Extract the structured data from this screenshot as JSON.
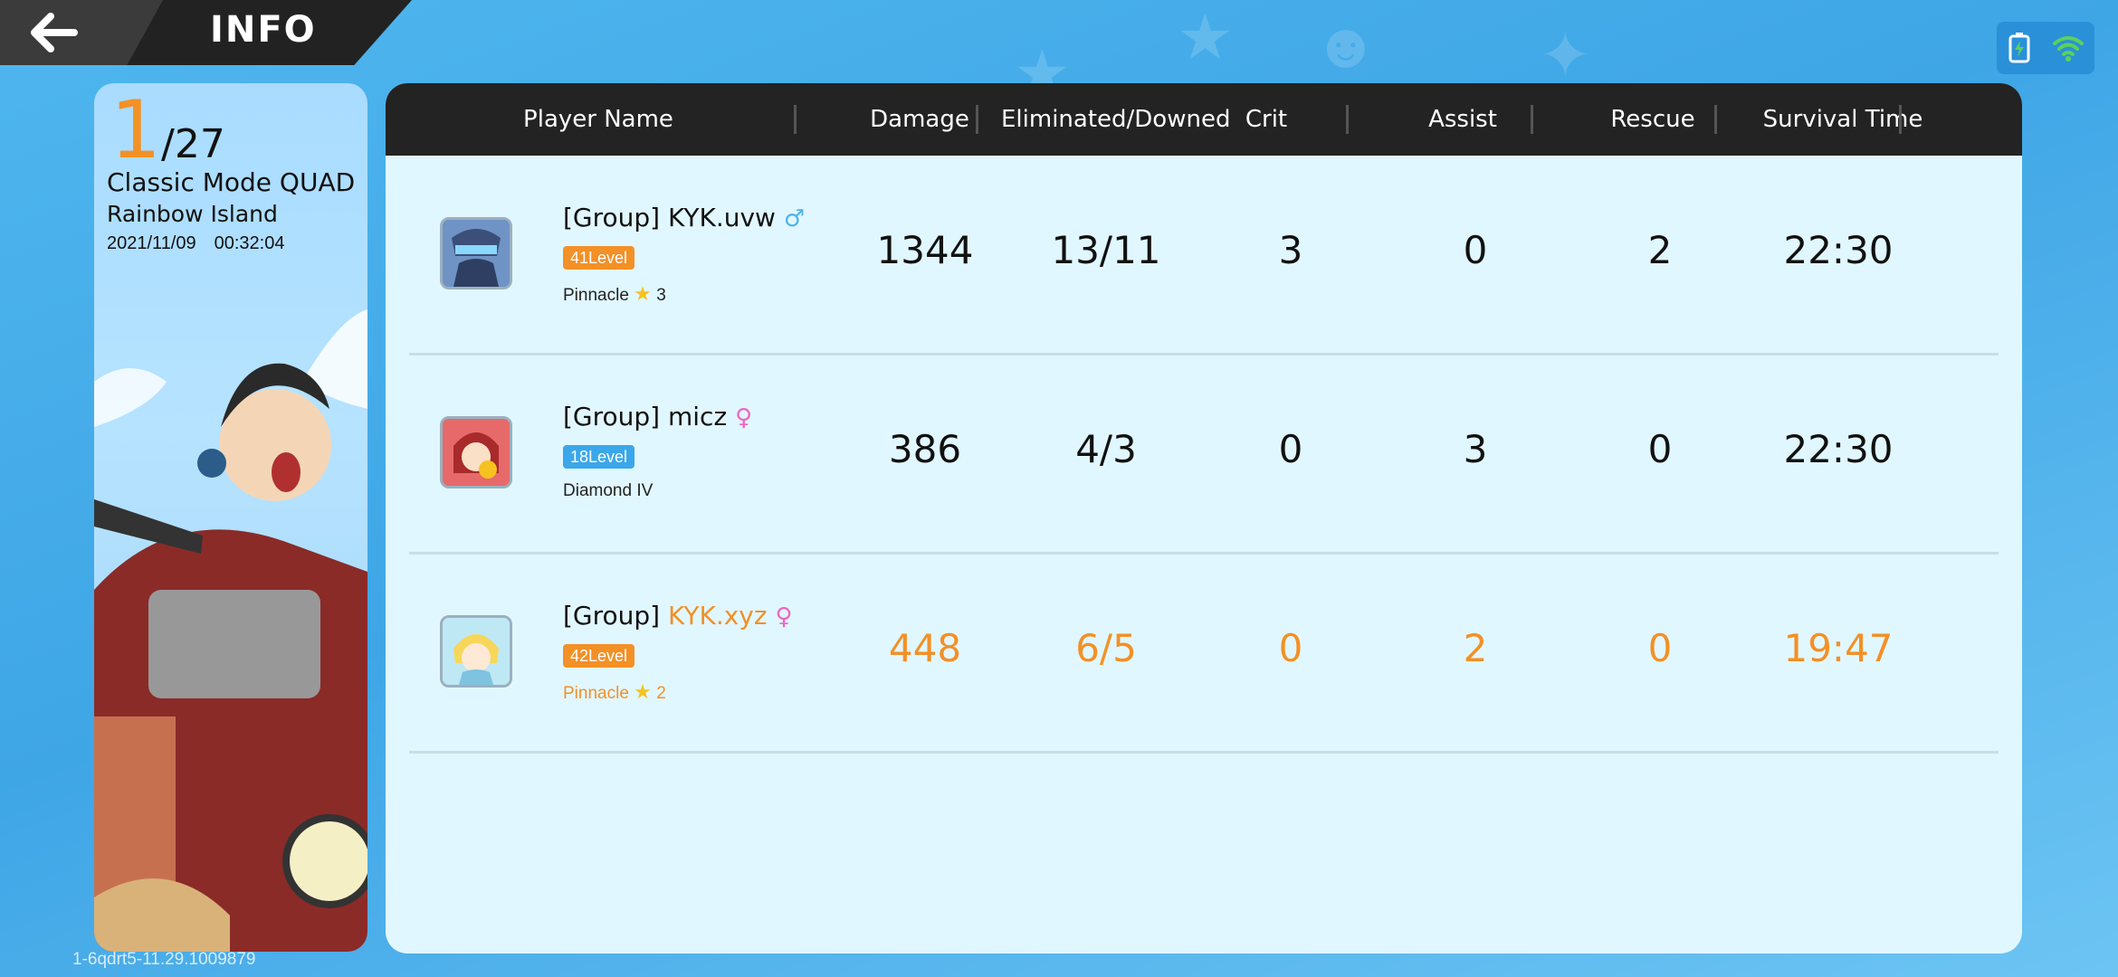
{
  "header": {
    "title": "INFO",
    "back_icon": "back-arrow-icon"
  },
  "status": {
    "icons": [
      "battery-charging-icon",
      "wifi-icon"
    ]
  },
  "match": {
    "rank": "1",
    "total": "/27",
    "mode": "Classic Mode QUAD",
    "map": "Rainbow Island",
    "date": "2021/11/09",
    "time": "00:32:04"
  },
  "table": {
    "headers": [
      "Player Name",
      "Damage",
      "Eliminated/Downed",
      "Crit",
      "Assist",
      "Rescue",
      "Survival Time"
    ],
    "rows": [
      {
        "group": "[Group]",
        "name": "KYK.uvw",
        "gender_icon": "male-icon",
        "level": "41Level",
        "level_color": "#f39026",
        "rank": "Pinnacle",
        "stars": "3",
        "damage": "1344",
        "elim": "13/11",
        "crit": "3",
        "assist": "0",
        "rescue": "2",
        "survival": "22:30",
        "highlight": false
      },
      {
        "group": "[Group]",
        "name": "micz",
        "gender_icon": "female-icon",
        "level": "18Level",
        "level_color": "#3aa7ea",
        "rank": "Diamond IV",
        "stars": "",
        "damage": "386",
        "elim": "4/3",
        "crit": "0",
        "assist": "3",
        "rescue": "0",
        "survival": "22:30",
        "highlight": false
      },
      {
        "group": "[Group]",
        "name": "KYK.xyz",
        "gender_icon": "female-icon",
        "level": "42Level",
        "level_color": "#f39026",
        "rank": "Pinnacle",
        "stars": "2",
        "damage": "448",
        "elim": "6/5",
        "crit": "0",
        "assist": "2",
        "rescue": "0",
        "survival": "19:47",
        "highlight": true
      }
    ]
  },
  "footer": {
    "version": "1-6qdrt5-11.29.1009879"
  },
  "colors": {
    "accent": "#f39026",
    "header_bg": "#232323",
    "panel_bg": "#e1f7ff"
  }
}
